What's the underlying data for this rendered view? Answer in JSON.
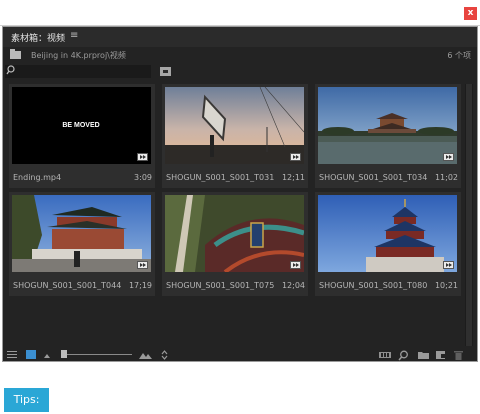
{
  "window": {
    "close_label": "x"
  },
  "panel": {
    "tab_title": "素材箱：视频",
    "menu_glyph": "≡",
    "path": "Beijing in 4K.prproj\\视频",
    "item_count": "6 个项"
  },
  "clips": [
    {
      "name": "Ending.mp4",
      "duration": "3:09",
      "thumb_text": "BE MOVED"
    },
    {
      "name": "SHOGUN_S001_S001_T031...",
      "duration": "12;11"
    },
    {
      "name": "SHOGUN_S001_S001_T034...",
      "duration": "11;02"
    },
    {
      "name": "SHOGUN_S001_S001_T044...",
      "duration": "17;19"
    },
    {
      "name": "SHOGUN_S001_S001_T075...",
      "duration": "12;04"
    },
    {
      "name": "SHOGUN_S001_S001_T080...",
      "duration": "10;21"
    }
  ],
  "toolbar": {
    "zoom_level": 0.0
  },
  "icons": {
    "list_view": "list-view-icon",
    "icon_view": "icon-view-icon",
    "search": "search-icon",
    "new_bin": "new-bin-icon",
    "new_item": "new-item-icon",
    "trash": "trash-icon",
    "automate": "automate-to-sequence-icon",
    "find": "find-icon"
  },
  "colors": {
    "accent": "#2aa7d6",
    "close": "#e8443f",
    "panel_bg": "#232323"
  },
  "tips": {
    "label": "Tips:"
  }
}
